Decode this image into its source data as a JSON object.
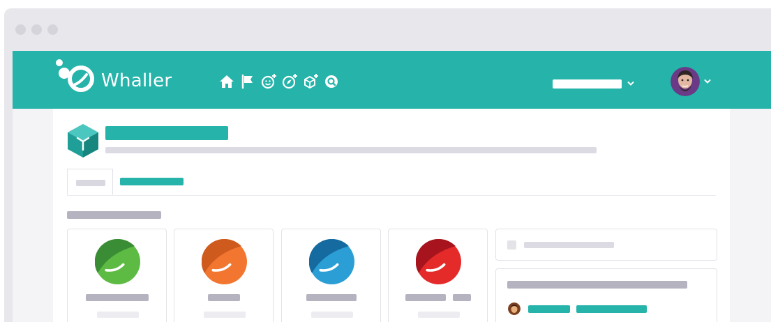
{
  "header": {
    "brand_name": "Whaller",
    "nav_icons": [
      "home-icon",
      "flag-icon",
      "add-smiley-icon",
      "add-compass-icon",
      "add-cube-icon",
      "search-icon"
    ],
    "space_selector_value": "",
    "user_menu": "avatar"
  },
  "colors": {
    "accent": "#25b3aa",
    "placeholder_dark": "#b5b3bf",
    "placeholder_light": "#dcdbe4",
    "page_bg": "#f4f4f6",
    "chrome": "#e7e7ec"
  },
  "space": {
    "icon": "cube-icon",
    "title": "",
    "description": ""
  },
  "tabs": [
    {
      "label": "",
      "active": true
    },
    {
      "label": "",
      "active": false
    }
  ],
  "section_title": "",
  "spheres": [
    {
      "color_dark": "#3a8d35",
      "color_light": "#5dbb43",
      "label": ""
    },
    {
      "color_dark": "#cf5a1e",
      "color_light": "#f27630",
      "label": ""
    },
    {
      "color_dark": "#156aa0",
      "color_light": "#2a9ed5",
      "label": ""
    },
    {
      "color_dark": "#a8141d",
      "color_light": "#e52a2a",
      "label": ""
    }
  ],
  "sidebar": {
    "search_placeholder": "",
    "card_title": ""
  }
}
